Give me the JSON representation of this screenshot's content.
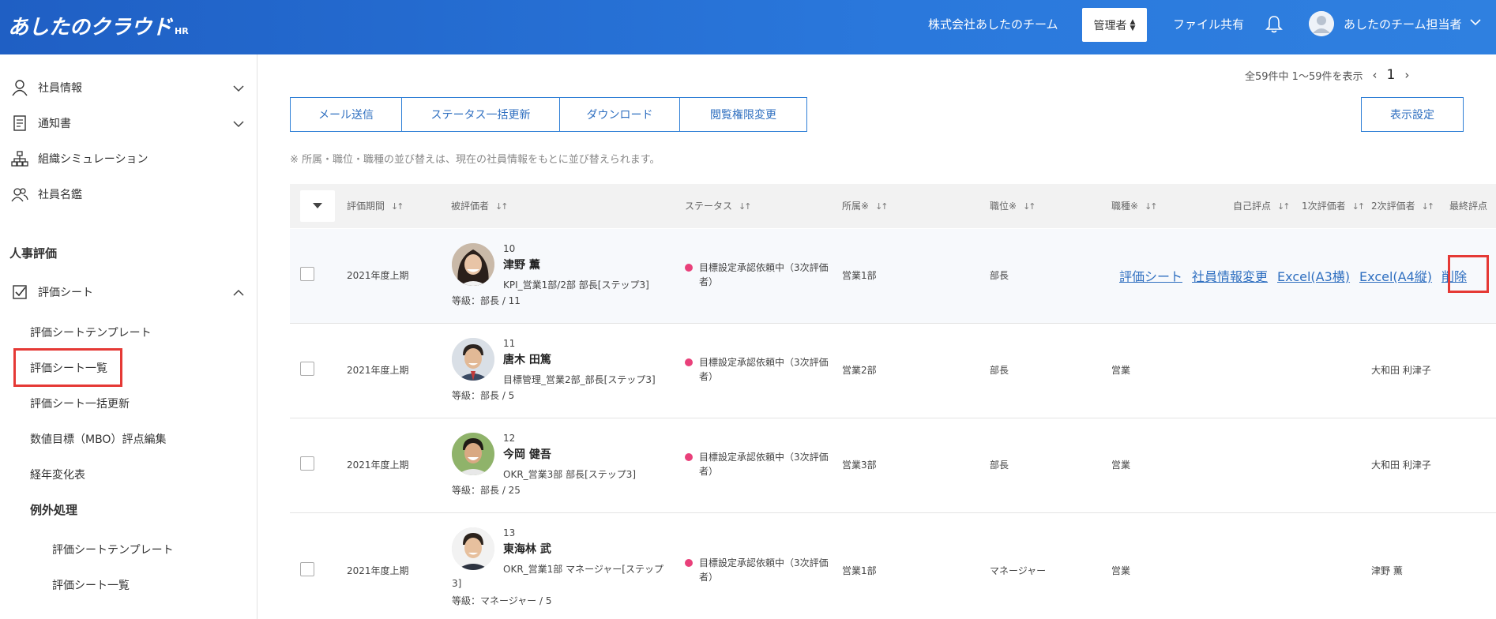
{
  "header": {
    "logo": "あしたのクラウド",
    "logo_sub": "HR",
    "company": "株式会社あしたのチーム",
    "role": "管理者",
    "file_share": "ファイル共有",
    "user": "あしたのチーム担当者"
  },
  "sidebar": {
    "items": [
      {
        "label": "社員情報",
        "icon": "person-icon"
      },
      {
        "label": "通知書",
        "icon": "document-icon"
      },
      {
        "label": "組織シミュレーション",
        "icon": "org-chart-icon"
      },
      {
        "label": "社員名鑑",
        "icon": "people-icon"
      }
    ],
    "section_hr": "人事評価",
    "eval_sheet": "評価シート",
    "sub_items": [
      "評価シートテンプレート",
      "評価シート一覧",
      "評価シート一括更新",
      "数値目標（MBO）評点編集",
      "経年変化表"
    ],
    "exception": "例外処理",
    "exception_items": [
      "評価シートテンプレート",
      "評価シート一覧"
    ]
  },
  "paging": {
    "summary": "全59件中 1〜59件を表示",
    "page": "1"
  },
  "toolbar": {
    "buttons": [
      "メール送信",
      "ステータス一括更新",
      "ダウンロード",
      "閲覧権限変更"
    ],
    "display_settings": "表示設定"
  },
  "note": "※ 所属・職位・職種の並び替えは、現在の社員情報をもとに並び替えられます。",
  "table": {
    "headers": [
      "評価期間",
      "被評価者",
      "ステータス",
      "所属※",
      "職位※",
      "職種※",
      "自己評点",
      "1次評価者",
      "2次評価者",
      "最終評点"
    ],
    "rows": [
      {
        "period": "2021年度上期",
        "no": "10",
        "name": "津野 薫",
        "desc": "KPI_営業1部/2部 部長[ステップ3]",
        "grade": "等級：部長 / 11",
        "status": "目標設定承認依頼中（3次評価者）",
        "dept": "営業1部",
        "position": "部長",
        "job": "",
        "evaluator2": "",
        "links": [
          "評価シート",
          "社員情報変更",
          "Excel(A3横)",
          "Excel(A4縦)",
          "削除"
        ]
      },
      {
        "period": "2021年度上期",
        "no": "11",
        "name": "唐木 田篤",
        "desc": "目標管理_営業2部_部長[ステップ3]",
        "grade": "等級：部長 / 5",
        "status": "目標設定承認依頼中（3次評価者）",
        "dept": "営業2部",
        "position": "部長",
        "job": "営業",
        "evaluator2": "大和田 利津子"
      },
      {
        "period": "2021年度上期",
        "no": "12",
        "name": "今岡 健吾",
        "desc": "OKR_営業3部 部長[ステップ3]",
        "grade": "等級：部長 / 25",
        "status": "目標設定承認依頼中（3次評価者）",
        "dept": "営業3部",
        "position": "部長",
        "job": "営業",
        "evaluator2": "大和田 利津子"
      },
      {
        "period": "2021年度上期",
        "no": "13",
        "name": "東海林 武",
        "desc": "OKR_営業1部 マネージャー[ステップ",
        "desc2": "3]",
        "grade": "等級：マネージャー / 5",
        "status": "目標設定承認依頼中（3次評価者）",
        "dept": "営業1部",
        "position": "マネージャー",
        "job": "営業",
        "evaluator2": "津野 薫"
      }
    ]
  }
}
